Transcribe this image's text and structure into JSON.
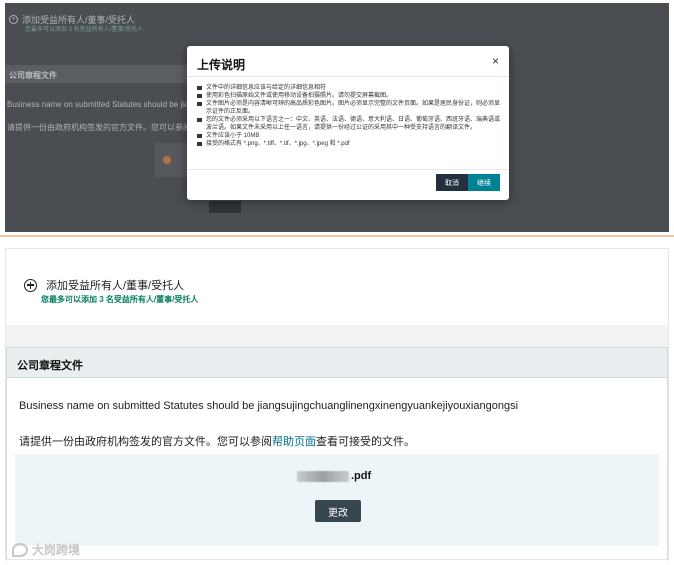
{
  "top_screenshot": {
    "background": {
      "add_label": "添加受益所有人/董事/受托人",
      "add_sub": "您最多可以添加 3 名受益所有人/董事/受托人",
      "section_title": "公司章程文件",
      "line1": "Business name on submitted Statutes should be jiang",
      "line2": "请提供一份由政府机构签发的官方文件。您可以参阅"
    },
    "modal": {
      "title": "上传说明",
      "close_label": "×",
      "items": [
        "文件中的详细信息应该与给定的详细信息相符",
        "使用彩色扫描原始文件或使用移动设备拍摄照片。请勿提交屏幕截图。",
        "文件图片必须是内容清晰可辨的高品质彩色图片。图片必须显示完整的文件页面。如果是居民身份证，则必须显示证件的正反面。",
        "您的文件必须采用以下语言之一：中文、英语、法语、德语、意大利语、日语、葡萄牙语、西班牙语、瑞典语或波兰语。如果文件未采用以上任一语言，请提供一份经过公证的采用其中一种受支持语言的翻译文件。",
        "文件应该小于 10MB",
        "接受的格式有 *.png、*.tiff、*.tif、*.jpg、*.jpeg 和 *.pdf"
      ],
      "cancel_label": "取消",
      "continue_label": "继续"
    }
  },
  "bottom_screenshot": {
    "add_label": "添加受益所有人/董事/受托人",
    "add_sub": "您最多可以添加 3 名受益所有人/董事/受托人",
    "section_title": "公司章程文件",
    "business_line": "Business name on submitted Statutes should be jiangsujingchuanglinengxinengyuankejiyouxiangongsi",
    "doc_prefix": "请提供一份由政府机构签发的官方文件。您可以参阅",
    "doc_link": "帮助页面",
    "doc_suffix": "查看可接受的文件。",
    "file_ext": ".pdf",
    "change_label": "更改"
  },
  "watermark": "大岗跨境",
  "colors": {
    "link": "#007185",
    "accent_green": "#067d62",
    "continue_button": "#008296",
    "cancel_button": "#232f3e",
    "upload_bg": "#eef5f8"
  }
}
